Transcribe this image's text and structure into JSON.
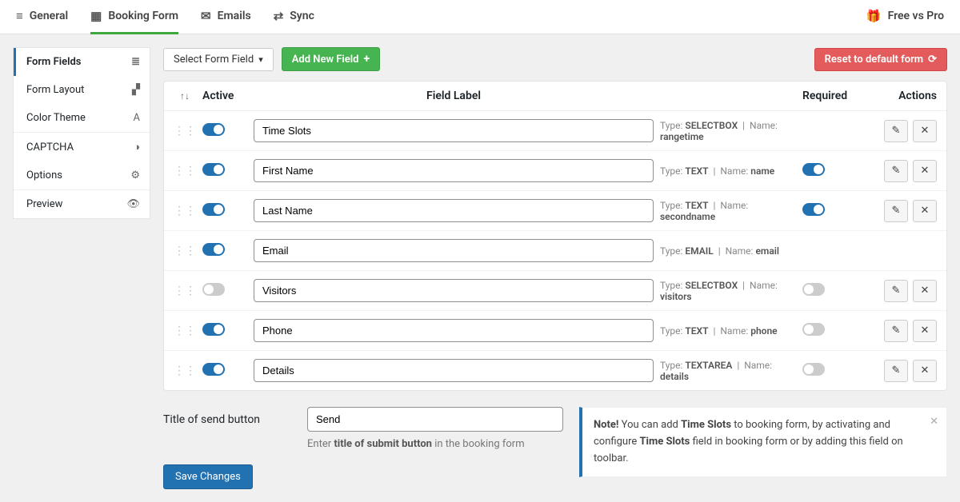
{
  "topNav": {
    "items": [
      {
        "key": "general",
        "label": "General",
        "icon": "sliders-icon",
        "glyph": "≡"
      },
      {
        "key": "booking",
        "label": "Booking Form",
        "icon": "form-icon",
        "glyph": "▦",
        "active": true
      },
      {
        "key": "emails",
        "label": "Emails",
        "icon": "mail-icon",
        "glyph": "✉"
      },
      {
        "key": "sync",
        "label": "Sync",
        "icon": "sync-icon",
        "glyph": "⇄"
      }
    ],
    "right": {
      "label": "Free vs Pro",
      "icon": "gift-icon",
      "glyph": "🎁"
    }
  },
  "sidebar": {
    "groups": [
      [
        {
          "key": "form-fields",
          "label": "Form Fields",
          "icon": "list-icon",
          "glyph": "≣",
          "active": true
        },
        {
          "key": "form-layout",
          "label": "Form Layout",
          "icon": "layout-icon",
          "glyph": "▞"
        },
        {
          "key": "color-theme",
          "label": "Color Theme",
          "icon": "theme-icon",
          "glyph": "A"
        }
      ],
      [
        {
          "key": "captcha",
          "label": "CAPTCHA",
          "icon": "captcha-icon",
          "glyph": "◑"
        },
        {
          "key": "options",
          "label": "Options",
          "icon": "options-icon",
          "glyph": "⚙"
        }
      ],
      [
        {
          "key": "preview",
          "label": "Preview",
          "icon": "eye-icon",
          "glyph": "👁"
        }
      ]
    ]
  },
  "toolbar": {
    "selectFieldLabel": "Select Form Field",
    "addNewFieldLabel": "Add New Field",
    "resetLabel": "Reset to default form"
  },
  "tableHeader": {
    "active": "Active",
    "fieldLabel": "Field Label",
    "required": "Required",
    "actions": "Actions"
  },
  "meta": {
    "typeLabel": "Type:",
    "nameLabel": "Name:"
  },
  "fields": [
    {
      "active": true,
      "label": "Time Slots",
      "type": "SELECTBOX",
      "name": "rangetime",
      "required": null,
      "hasEdit": true,
      "hasDelete": true
    },
    {
      "active": true,
      "label": "First Name",
      "type": "TEXT",
      "name": "name",
      "required": true,
      "hasEdit": true,
      "hasDelete": true
    },
    {
      "active": true,
      "label": "Last Name",
      "type": "TEXT",
      "name": "secondname",
      "required": true,
      "hasEdit": true,
      "hasDelete": true
    },
    {
      "active": true,
      "label": "Email",
      "type": "EMAIL",
      "name": "email",
      "required": null,
      "hasEdit": false,
      "hasDelete": false
    },
    {
      "active": false,
      "label": "Visitors",
      "type": "SELECTBOX",
      "name": "visitors",
      "required": false,
      "hasEdit": true,
      "hasDelete": true
    },
    {
      "active": true,
      "label": "Phone",
      "type": "TEXT",
      "name": "phone",
      "required": false,
      "hasEdit": true,
      "hasDelete": true
    },
    {
      "active": true,
      "label": "Details",
      "type": "TEXTAREA",
      "name": "details",
      "required": false,
      "hasEdit": true,
      "hasDelete": true
    }
  ],
  "sendTitle": {
    "label": "Title of send button",
    "value": "Send",
    "helperPrefix": "Enter ",
    "helperBold": "title of submit button",
    "helperSuffix": " in the booking form"
  },
  "note": {
    "boldLead": "Note!",
    "part1": " You can add ",
    "bold1": "Time Slots",
    "part2": " to booking form, by activating and configure ",
    "bold2": "Time Slots",
    "part3": " field in booking form or by adding this field on toolbar."
  },
  "saveButtonLabel": "Save Changes"
}
